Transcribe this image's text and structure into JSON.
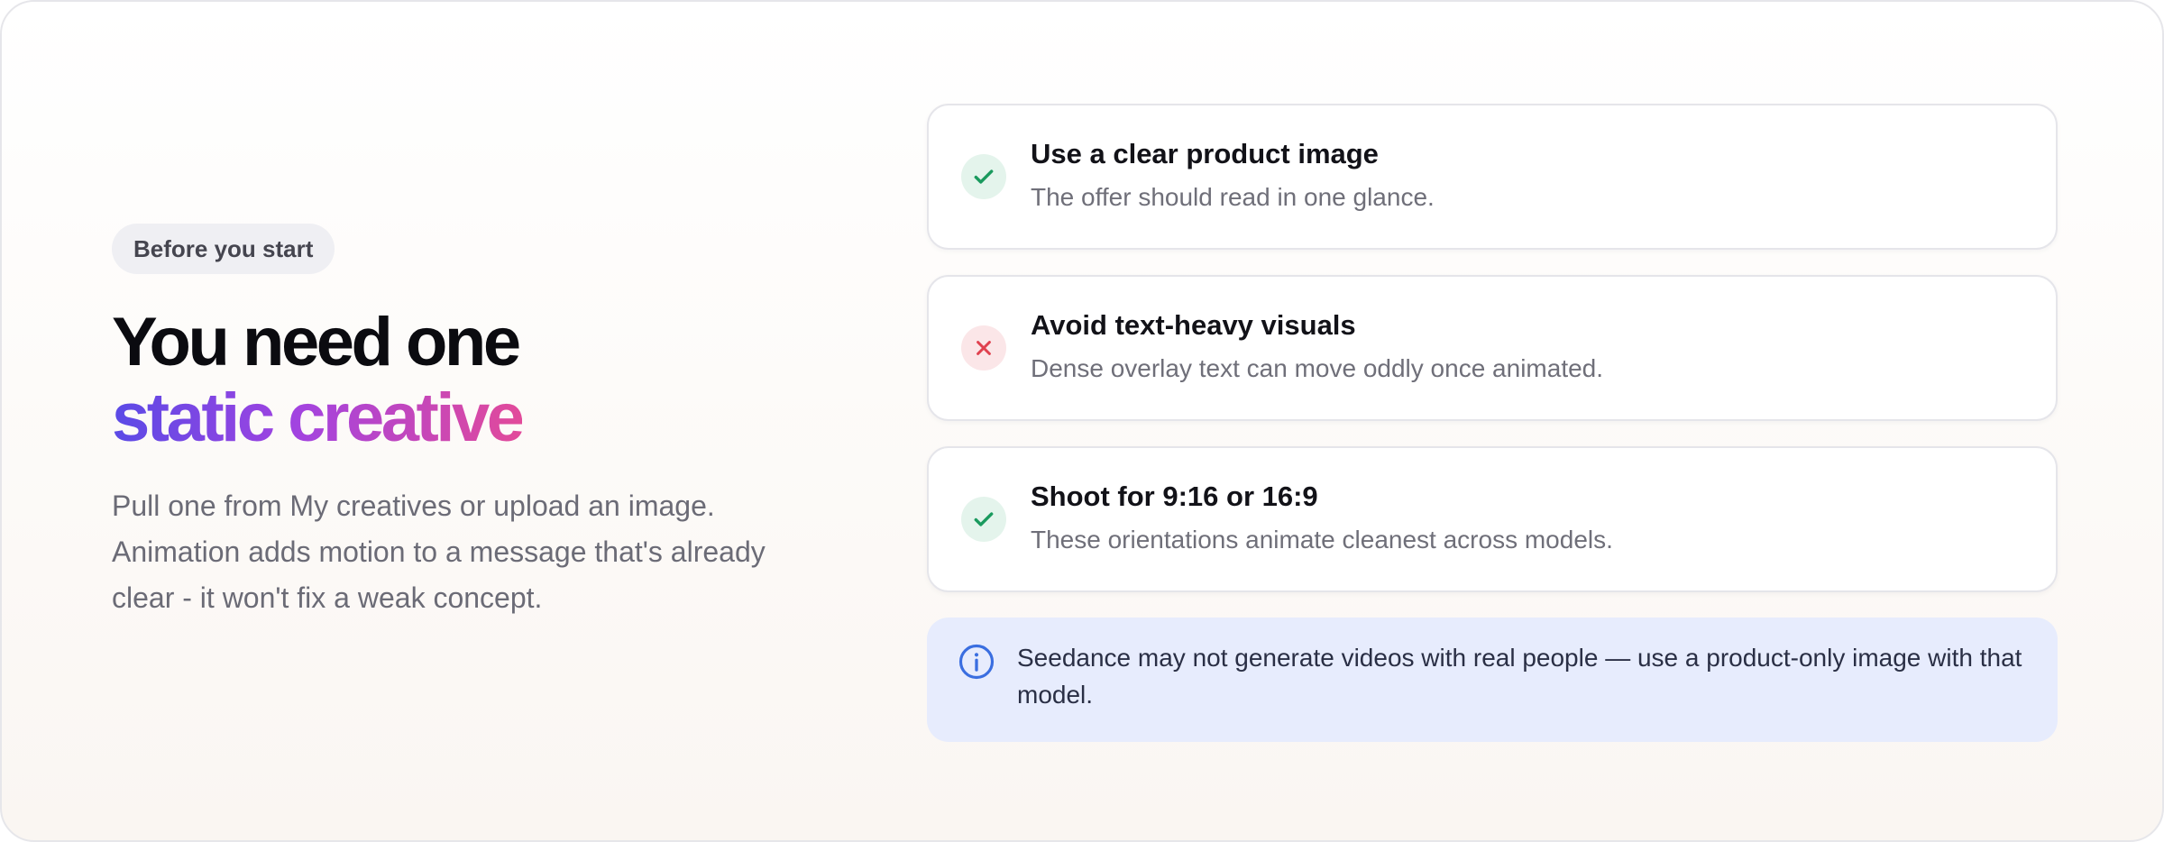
{
  "intro": {
    "badge": "Before you start",
    "headline_line1": "You need one",
    "headline_line2": "static creative",
    "description": "Pull one from My creatives or upload an image. Animation adds motion to a message that's already clear - it won't fix a weak concept."
  },
  "tips": [
    {
      "status": "do",
      "icon": "check-icon",
      "title": "Use a clear product image",
      "subtitle": "The offer should read in one glance."
    },
    {
      "status": "dont",
      "icon": "x-icon",
      "title": "Avoid text-heavy visuals",
      "subtitle": "Dense overlay text can move oddly once animated."
    },
    {
      "status": "do",
      "icon": "check-icon",
      "title": "Shoot for 9:16 or 16:9",
      "subtitle": "These orientations animate cleanest across models."
    }
  ],
  "note": {
    "icon": "info-icon",
    "text": "Seedance may not generate videos with real people — use a product-only image with that model."
  },
  "colors": {
    "success": "#1a9a5e",
    "danger": "#e0414f",
    "info": "#3a6ee0",
    "gradient_start": "#5a4ae6",
    "gradient_end": "#e24a9a"
  }
}
